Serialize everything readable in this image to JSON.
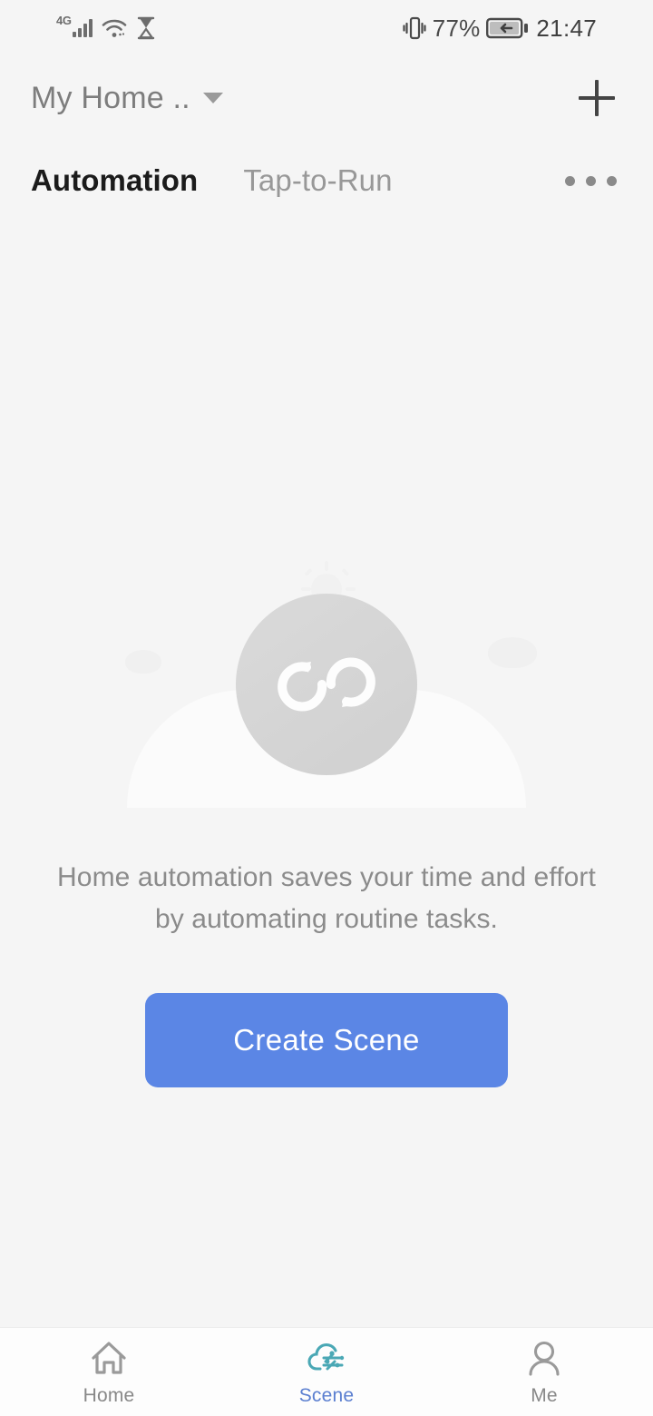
{
  "status_bar": {
    "network_type": "4G",
    "signal_icon": "signal-bars-icon",
    "wifi_icon": "wifi-icon",
    "hourglass_icon": "hourglass-icon",
    "vibrate_icon": "vibrate-icon",
    "battery_percent": "77%",
    "battery_icon": "battery-charging-icon",
    "time": "21:47"
  },
  "header": {
    "home_name": "My Home ..",
    "dropdown_icon": "chevron-down-icon",
    "add_icon": "plus-icon"
  },
  "tabs": {
    "items": [
      {
        "label": "Automation",
        "active": true
      },
      {
        "label": "Tap-to-Run",
        "active": false
      }
    ],
    "overflow_icon": "more-horizontal-icon"
  },
  "empty_state": {
    "illustration_icon": "automation-loop-icon",
    "description": "Home automation saves your time and effort by automating routine tasks.",
    "cta_label": "Create Scene"
  },
  "bottom_nav": {
    "items": [
      {
        "label": "Home",
        "icon": "house-icon",
        "active": false
      },
      {
        "label": "Scene",
        "icon": "scene-cloud-icon",
        "active": true
      },
      {
        "label": "Me",
        "icon": "person-icon",
        "active": false
      }
    ]
  },
  "colors": {
    "background": "#f5f5f5",
    "accent_blue": "#5b86e5",
    "nav_active": "#5b7fd0",
    "scene_icon_teal": "#4aa8b5",
    "text_primary": "#1b1b1b",
    "text_muted": "#8b8b8b"
  }
}
